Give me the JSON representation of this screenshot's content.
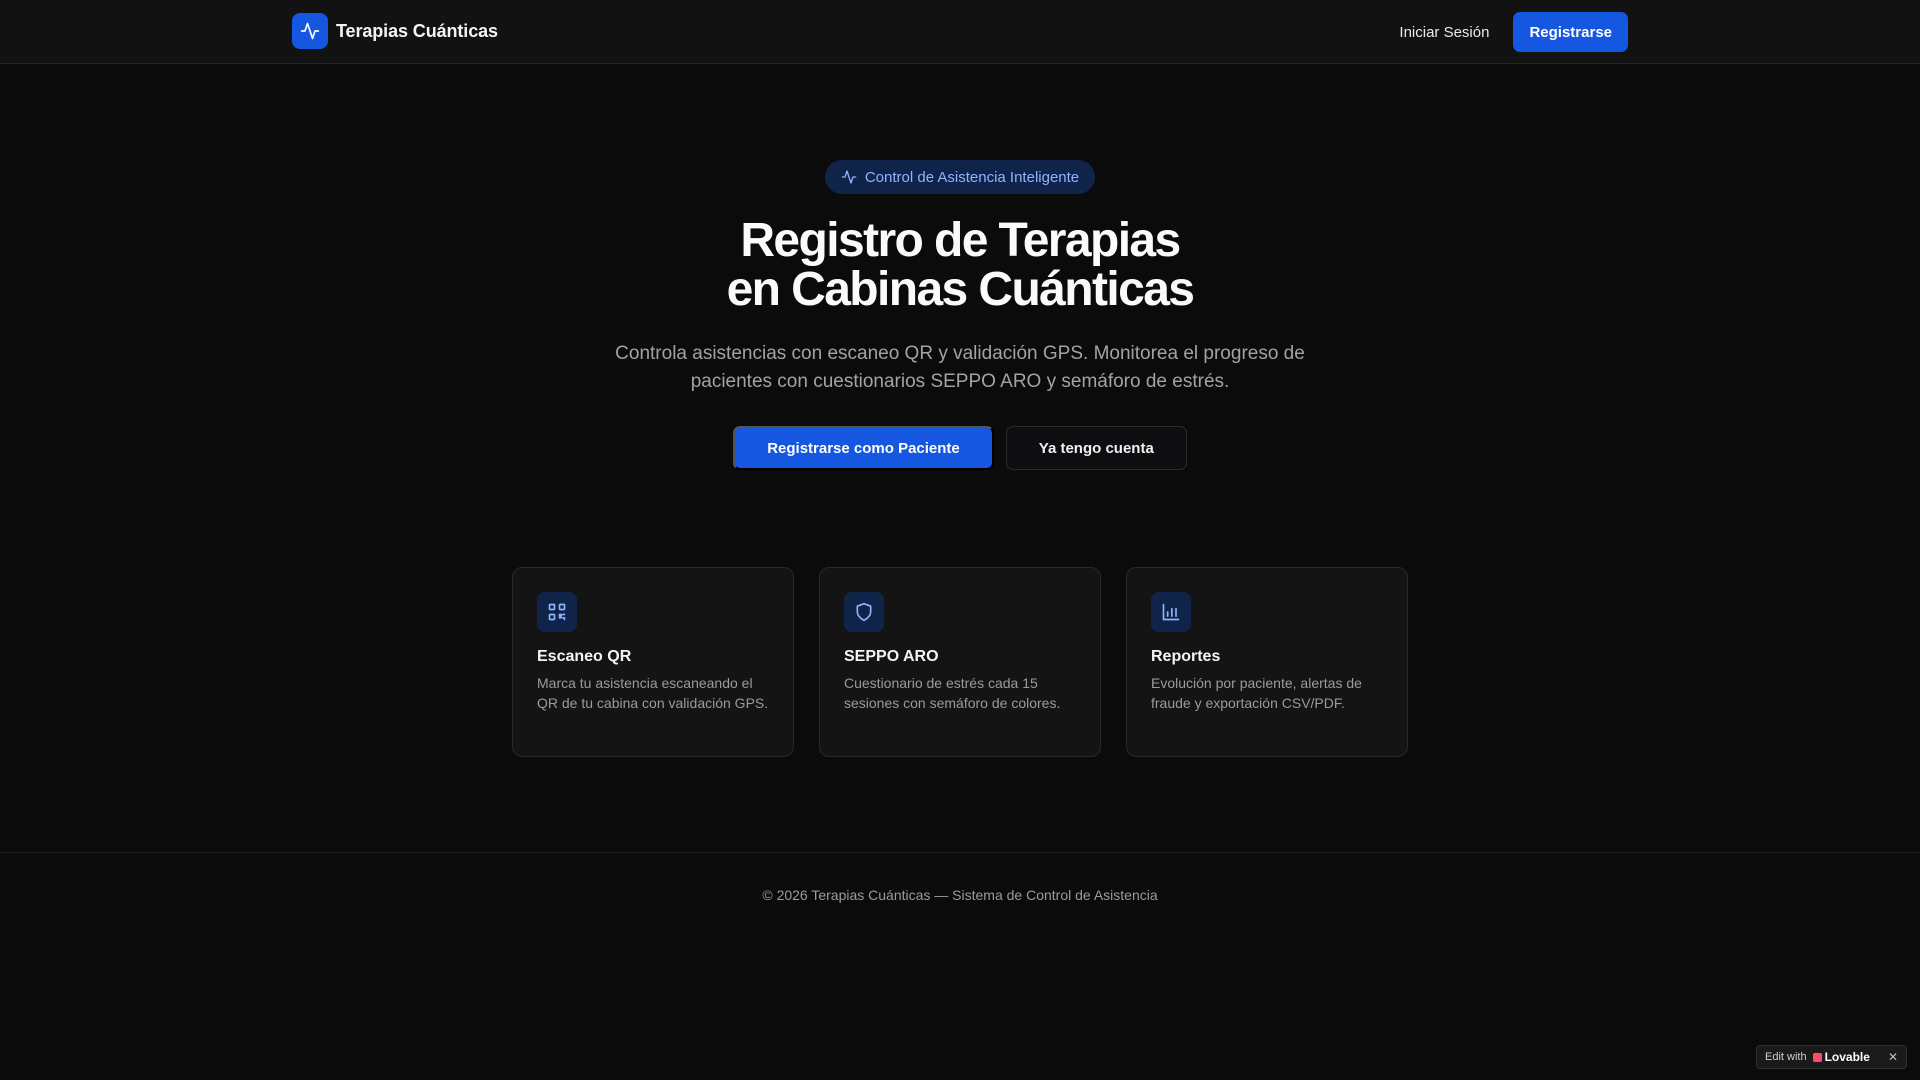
{
  "header": {
    "brand_name": "Terapias Cuánticas",
    "login_label": "Iniciar Sesión",
    "register_label": "Registrarse"
  },
  "hero": {
    "pill_label": "Control de Asistencia Inteligente",
    "title_line1": "Registro de Terapias",
    "title_line2": "en Cabinas Cuánticas",
    "subtitle": "Controla asistencias con escaneo QR y validación GPS. Monitorea el progreso de pacientes con cuestionarios SEPPO ARO y semáforo de estrés.",
    "primary_cta": "Registrarse como Paciente",
    "secondary_cta": "Ya tengo cuenta"
  },
  "features": [
    {
      "icon": "qr-code-icon",
      "title": "Escaneo QR",
      "description": "Marca tu asistencia escaneando el QR de tu cabina con validación GPS."
    },
    {
      "icon": "shield-icon",
      "title": "SEPPO ARO",
      "description": "Cuestionario de estrés cada 15 sesiones con semáforo de colores."
    },
    {
      "icon": "bar-chart-icon",
      "title": "Reportes",
      "description": "Evolución por paciente, alertas de fraude y exportación CSV/PDF."
    }
  ],
  "footer": {
    "text": "© 2026 Terapias Cuánticas — Sistema de Control de Asistencia"
  },
  "badge": {
    "prefix": "Edit with",
    "brand": "Lovable",
    "close": "✕"
  },
  "colors": {
    "accent": "#1557e0",
    "background": "#0b0b0c",
    "card": "#141415",
    "pill_bg": "#10244a",
    "pill_text": "#8fb3ff"
  }
}
